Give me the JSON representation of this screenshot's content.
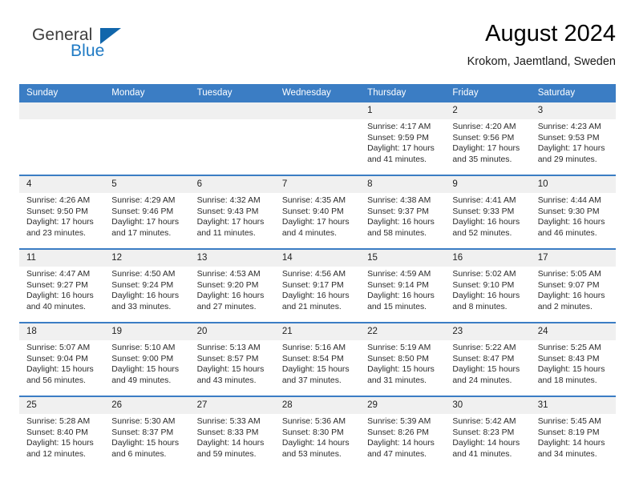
{
  "logo": {
    "word1": "General",
    "word2": "Blue",
    "triangle_color": "#1166ab",
    "word1_color": "#3d3d3d",
    "word2_color": "#1f7ac4"
  },
  "header": {
    "title": "August 2024",
    "subtitle": "Krokom, Jaemtland, Sweden"
  },
  "theme": {
    "header_blue": "#3b7dc4",
    "daynum_band": "#f0f0f0",
    "text": "#2b2b2b"
  },
  "calendar": {
    "weekday_headers": [
      "Sunday",
      "Monday",
      "Tuesday",
      "Wednesday",
      "Thursday",
      "Friday",
      "Saturday"
    ],
    "weeks": [
      [
        {
          "day": "",
          "lines": []
        },
        {
          "day": "",
          "lines": []
        },
        {
          "day": "",
          "lines": []
        },
        {
          "day": "",
          "lines": []
        },
        {
          "day": "1",
          "lines": [
            "Sunrise: 4:17 AM",
            "Sunset: 9:59 PM",
            "Daylight: 17 hours and 41 minutes."
          ]
        },
        {
          "day": "2",
          "lines": [
            "Sunrise: 4:20 AM",
            "Sunset: 9:56 PM",
            "Daylight: 17 hours and 35 minutes."
          ]
        },
        {
          "day": "3",
          "lines": [
            "Sunrise: 4:23 AM",
            "Sunset: 9:53 PM",
            "Daylight: 17 hours and 29 minutes."
          ]
        }
      ],
      [
        {
          "day": "4",
          "lines": [
            "Sunrise: 4:26 AM",
            "Sunset: 9:50 PM",
            "Daylight: 17 hours and 23 minutes."
          ]
        },
        {
          "day": "5",
          "lines": [
            "Sunrise: 4:29 AM",
            "Sunset: 9:46 PM",
            "Daylight: 17 hours and 17 minutes."
          ]
        },
        {
          "day": "6",
          "lines": [
            "Sunrise: 4:32 AM",
            "Sunset: 9:43 PM",
            "Daylight: 17 hours and 11 minutes."
          ]
        },
        {
          "day": "7",
          "lines": [
            "Sunrise: 4:35 AM",
            "Sunset: 9:40 PM",
            "Daylight: 17 hours and 4 minutes."
          ]
        },
        {
          "day": "8",
          "lines": [
            "Sunrise: 4:38 AM",
            "Sunset: 9:37 PM",
            "Daylight: 16 hours and 58 minutes."
          ]
        },
        {
          "day": "9",
          "lines": [
            "Sunrise: 4:41 AM",
            "Sunset: 9:33 PM",
            "Daylight: 16 hours and 52 minutes."
          ]
        },
        {
          "day": "10",
          "lines": [
            "Sunrise: 4:44 AM",
            "Sunset: 9:30 PM",
            "Daylight: 16 hours and 46 minutes."
          ]
        }
      ],
      [
        {
          "day": "11",
          "lines": [
            "Sunrise: 4:47 AM",
            "Sunset: 9:27 PM",
            "Daylight: 16 hours and 40 minutes."
          ]
        },
        {
          "day": "12",
          "lines": [
            "Sunrise: 4:50 AM",
            "Sunset: 9:24 PM",
            "Daylight: 16 hours and 33 minutes."
          ]
        },
        {
          "day": "13",
          "lines": [
            "Sunrise: 4:53 AM",
            "Sunset: 9:20 PM",
            "Daylight: 16 hours and 27 minutes."
          ]
        },
        {
          "day": "14",
          "lines": [
            "Sunrise: 4:56 AM",
            "Sunset: 9:17 PM",
            "Daylight: 16 hours and 21 minutes."
          ]
        },
        {
          "day": "15",
          "lines": [
            "Sunrise: 4:59 AM",
            "Sunset: 9:14 PM",
            "Daylight: 16 hours and 15 minutes."
          ]
        },
        {
          "day": "16",
          "lines": [
            "Sunrise: 5:02 AM",
            "Sunset: 9:10 PM",
            "Daylight: 16 hours and 8 minutes."
          ]
        },
        {
          "day": "17",
          "lines": [
            "Sunrise: 5:05 AM",
            "Sunset: 9:07 PM",
            "Daylight: 16 hours and 2 minutes."
          ]
        }
      ],
      [
        {
          "day": "18",
          "lines": [
            "Sunrise: 5:07 AM",
            "Sunset: 9:04 PM",
            "Daylight: 15 hours and 56 minutes."
          ]
        },
        {
          "day": "19",
          "lines": [
            "Sunrise: 5:10 AM",
            "Sunset: 9:00 PM",
            "Daylight: 15 hours and 49 minutes."
          ]
        },
        {
          "day": "20",
          "lines": [
            "Sunrise: 5:13 AM",
            "Sunset: 8:57 PM",
            "Daylight: 15 hours and 43 minutes."
          ]
        },
        {
          "day": "21",
          "lines": [
            "Sunrise: 5:16 AM",
            "Sunset: 8:54 PM",
            "Daylight: 15 hours and 37 minutes."
          ]
        },
        {
          "day": "22",
          "lines": [
            "Sunrise: 5:19 AM",
            "Sunset: 8:50 PM",
            "Daylight: 15 hours and 31 minutes."
          ]
        },
        {
          "day": "23",
          "lines": [
            "Sunrise: 5:22 AM",
            "Sunset: 8:47 PM",
            "Daylight: 15 hours and 24 minutes."
          ]
        },
        {
          "day": "24",
          "lines": [
            "Sunrise: 5:25 AM",
            "Sunset: 8:43 PM",
            "Daylight: 15 hours and 18 minutes."
          ]
        }
      ],
      [
        {
          "day": "25",
          "lines": [
            "Sunrise: 5:28 AM",
            "Sunset: 8:40 PM",
            "Daylight: 15 hours and 12 minutes."
          ]
        },
        {
          "day": "26",
          "lines": [
            "Sunrise: 5:30 AM",
            "Sunset: 8:37 PM",
            "Daylight: 15 hours and 6 minutes."
          ]
        },
        {
          "day": "27",
          "lines": [
            "Sunrise: 5:33 AM",
            "Sunset: 8:33 PM",
            "Daylight: 14 hours and 59 minutes."
          ]
        },
        {
          "day": "28",
          "lines": [
            "Sunrise: 5:36 AM",
            "Sunset: 8:30 PM",
            "Daylight: 14 hours and 53 minutes."
          ]
        },
        {
          "day": "29",
          "lines": [
            "Sunrise: 5:39 AM",
            "Sunset: 8:26 PM",
            "Daylight: 14 hours and 47 minutes."
          ]
        },
        {
          "day": "30",
          "lines": [
            "Sunrise: 5:42 AM",
            "Sunset: 8:23 PM",
            "Daylight: 14 hours and 41 minutes."
          ]
        },
        {
          "day": "31",
          "lines": [
            "Sunrise: 5:45 AM",
            "Sunset: 8:19 PM",
            "Daylight: 14 hours and 34 minutes."
          ]
        }
      ]
    ]
  }
}
